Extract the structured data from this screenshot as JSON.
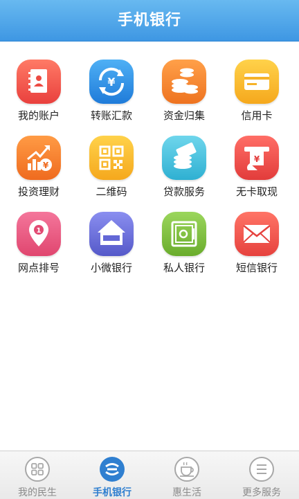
{
  "header": {
    "title": "手机银行"
  },
  "grid": {
    "items": [
      {
        "label": "我的账户",
        "icon": "account-book-icon",
        "color": "#f2594f"
      },
      {
        "label": "转账汇款",
        "icon": "transfer-yen-icon",
        "color": "#2f8ee5"
      },
      {
        "label": "资金归集",
        "icon": "coin-stack-icon",
        "color": "#f58b2e"
      },
      {
        "label": "信用卡",
        "icon": "credit-card-icon",
        "color": "#f8b82a"
      },
      {
        "label": "投资理财",
        "icon": "investment-chart-icon",
        "color": "#f5852b"
      },
      {
        "label": "二维码",
        "icon": "qr-code-icon",
        "color": "#f7b82a"
      },
      {
        "label": "贷款服务",
        "icon": "loan-coins-icon",
        "color": "#4fc3df"
      },
      {
        "label": "无卡取现",
        "icon": "cash-withdraw-icon",
        "color": "#ee5050"
      },
      {
        "label": "网点排号",
        "icon": "location-pin-icon",
        "color": "#e8507d"
      },
      {
        "label": "小微银行",
        "icon": "bank-house-icon",
        "color": "#6b6fd8"
      },
      {
        "label": "私人银行",
        "icon": "safe-box-icon",
        "color": "#7fc23e"
      },
      {
        "label": "短信银行",
        "icon": "envelope-icon",
        "color": "#f2594f"
      }
    ]
  },
  "tabbar": {
    "tabs": [
      {
        "label": "我的民生",
        "icon": "grid-icon",
        "active": false
      },
      {
        "label": "手机银行",
        "icon": "bank-logo-icon",
        "active": true
      },
      {
        "label": "惠生活",
        "icon": "coffee-cup-icon",
        "active": false
      },
      {
        "label": "更多服务",
        "icon": "menu-lines-icon",
        "active": false
      }
    ]
  },
  "colors": {
    "header": "#3e97e3",
    "tab_active": "#2f7fd0",
    "tab_inactive": "#8a8a8a"
  }
}
